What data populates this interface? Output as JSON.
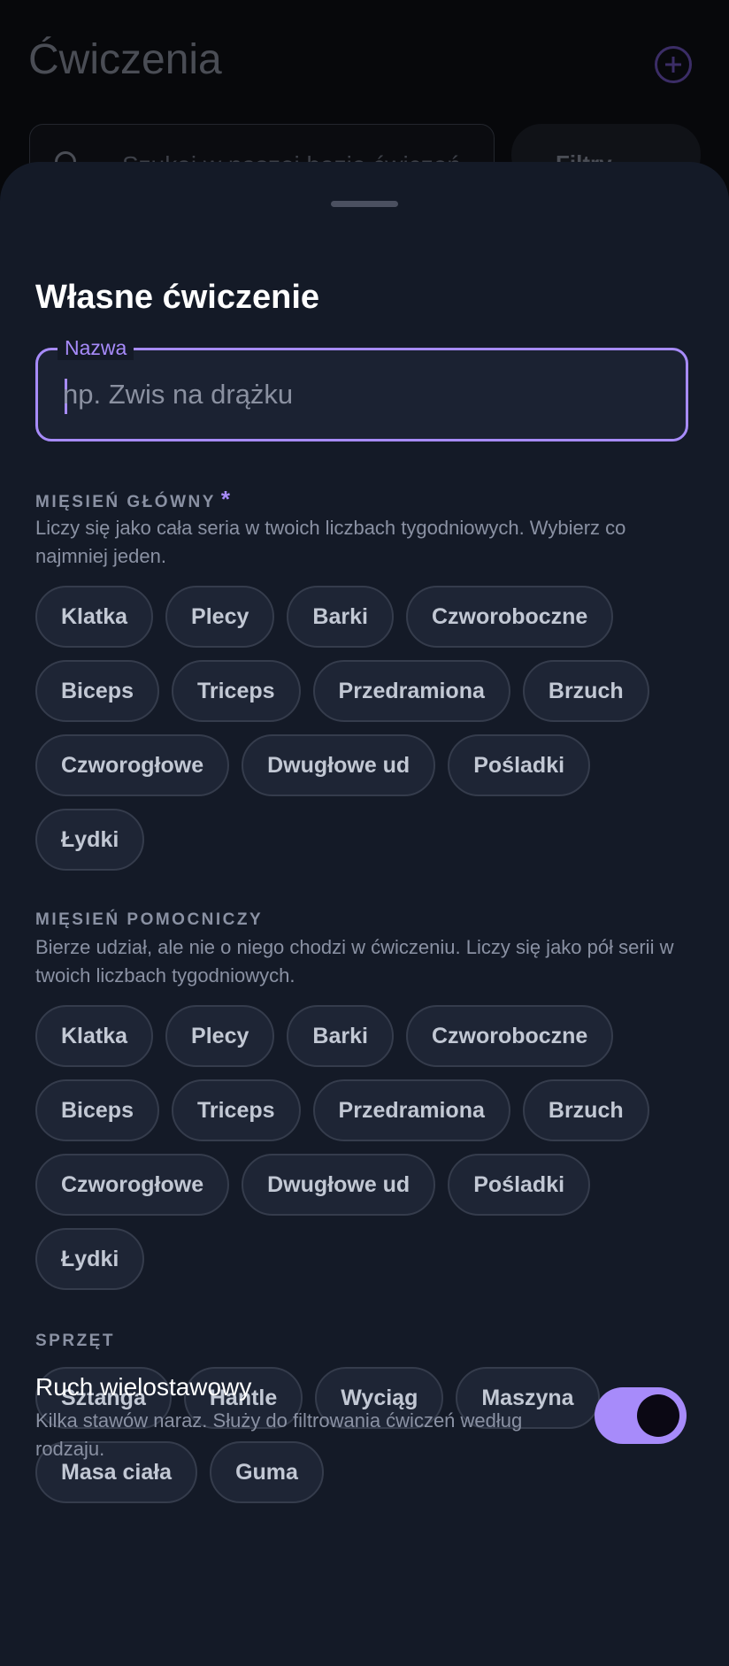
{
  "background": {
    "title": "Ćwiczenia",
    "search_text": "Szukaj w naszej bazie ćwiczeń",
    "filter_label": "Filtry"
  },
  "sheet": {
    "title": "Własne ćwiczenie",
    "name_field": {
      "label": "Nazwa",
      "value": "",
      "placeholder": "np. Zwis na drążku"
    },
    "primary_muscle": {
      "label": "MIĘSIEŃ GŁÓWNY",
      "required_mark": "*",
      "description": "Liczy się jako cała seria w twoich liczbach tygodniowych. Wybierz co najmniej jeden.",
      "chips": [
        "Klatka",
        "Plecy",
        "Barki",
        "Czworoboczne",
        "Biceps",
        "Triceps",
        "Przedramiona",
        "Brzuch",
        "Czworogłowe",
        "Dwugłowe ud",
        "Pośladki",
        "Łydki"
      ]
    },
    "secondary_muscle": {
      "label": "MIĘSIEŃ POMOCNICZY",
      "description": "Bierze udział, ale nie o niego chodzi w ćwiczeniu. Liczy się jako pół serii w twoich liczbach tygodniowych.",
      "chips": [
        "Klatka",
        "Plecy",
        "Barki",
        "Czworoboczne",
        "Biceps",
        "Triceps",
        "Przedramiona",
        "Brzuch",
        "Czworogłowe",
        "Dwugłowe ud",
        "Pośladki",
        "Łydki"
      ]
    },
    "equipment": {
      "label": "SPRZĘT",
      "chips": [
        "Sztanga",
        "Hantle",
        "Wyciąg",
        "Maszyna",
        "Masa ciała",
        "Guma"
      ]
    },
    "compound": {
      "title": "Ruch wielostawowy",
      "description": "Kilka stawów naraz. Służy do filtrowania ćwiczeń według rodzaju.",
      "enabled": true
    }
  },
  "colors": {
    "accent": "#a78bfa",
    "sheet_bg": "#141a27",
    "chip_bg": "#1e2535"
  }
}
